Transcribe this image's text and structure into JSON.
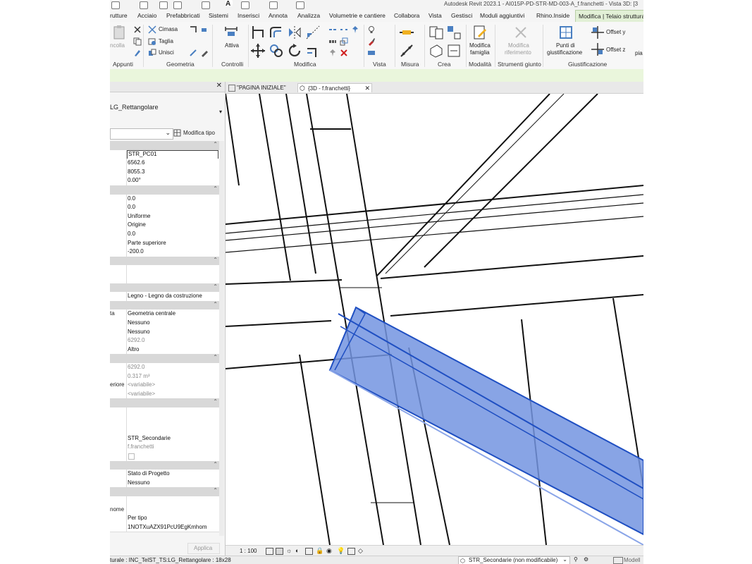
{
  "window": {
    "title": "Autodesk Revit 2023.1 - AI015P-PD-STR-MD-003-A_f.franchetti - Vista 3D: [3"
  },
  "ribbon_tabs": [
    "rutture",
    "Acciaio",
    "Prefabbricati",
    "Sistemi",
    "Inserisci",
    "Annota",
    "Analizza",
    "Volumetrie e cantiere",
    "Collabora",
    "Vista",
    "Gestisci",
    "Moduli aggiuntivi",
    "Rhino.Inside",
    "Modifica | Telaio struttura"
  ],
  "ribbon": {
    "groups": [
      "Appunti",
      "Geometria",
      "Controlli",
      "Modifica",
      "Vista",
      "Misura",
      "Crea",
      "Modalità",
      "Strumenti giunto",
      "Giustificazione"
    ],
    "clipboard_label": "ncolla",
    "cimasa_label": "Cimasa",
    "taglia_label": "Taglia",
    "unisci_label": "Unisci",
    "attiva_label": "Attiva",
    "modifica_famiglia_1": "Modifica",
    "modifica_famiglia_2": "famiglia",
    "modifica_rif_1": "Modifica",
    "modifica_rif_2": "riferimento",
    "punti_1": "Punti di",
    "punti_2": "giustificazione",
    "offset_y": "Offset y",
    "offset_z": "Offset z",
    "pia": "pia"
  },
  "properties": {
    "type_name": "LG_Rettangolare",
    "edit_type_label": "Modifica tipo",
    "apply_label": "Applica",
    "rows": [
      {
        "k": "",
        "v": "",
        "hdr": true
      },
      {
        "k": "",
        "v": "STR_PC01",
        "boxed": true
      },
      {
        "k": "",
        "v": "6562.6"
      },
      {
        "k": "",
        "v": "8055.3"
      },
      {
        "k": "",
        "v": "0.00°"
      },
      {
        "k": "",
        "v": "",
        "hdr": true
      },
      {
        "k": "",
        "v": "0.0"
      },
      {
        "k": "",
        "v": "0.0"
      },
      {
        "k": "",
        "v": "Uniforme"
      },
      {
        "k": "",
        "v": "Origine"
      },
      {
        "k": "",
        "v": "0.0"
      },
      {
        "k": "",
        "v": "Parte superiore"
      },
      {
        "k": "",
        "v": "-200.0"
      },
      {
        "k": "",
        "v": "",
        "hdr": true
      },
      {
        "k": "",
        "v": ""
      },
      {
        "k": "",
        "v": ""
      },
      {
        "k": "",
        "v": "",
        "hdr": true
      },
      {
        "k": "",
        "v": "Legno - Legno da costruzione"
      },
      {
        "k": "",
        "v": "",
        "hdr": true
      },
      {
        "k": "ta",
        "v": "Geometria centrale"
      },
      {
        "k": "",
        "v": "Nessuno"
      },
      {
        "k": "",
        "v": "Nessuno"
      },
      {
        "k": "",
        "v": "6292.0",
        "grey": true
      },
      {
        "k": "",
        "v": "Altro"
      },
      {
        "k": "",
        "v": "",
        "hdr": true
      },
      {
        "k": "",
        "v": "6292.0",
        "grey": true
      },
      {
        "k": "",
        "v": "0.317 m³",
        "grey": true
      },
      {
        "k": "eriore",
        "v": "<variabile>",
        "grey": true
      },
      {
        "k": "",
        "v": "<variabile>",
        "grey": true
      },
      {
        "k": "",
        "v": "",
        "hdr": true
      },
      {
        "k": "",
        "v": ""
      },
      {
        "k": "",
        "v": ""
      },
      {
        "k": "",
        "v": ""
      },
      {
        "k": "",
        "v": "STR_Secondarie"
      },
      {
        "k": "",
        "v": "f.franchetti",
        "grey": true
      },
      {
        "k": "",
        "v": "",
        "check": true
      },
      {
        "k": "",
        "v": "",
        "hdr": true
      },
      {
        "k": "",
        "v": "Stato di Progetto"
      },
      {
        "k": "",
        "v": "Nessuno"
      },
      {
        "k": "",
        "v": "",
        "hdr": true
      },
      {
        "k": "",
        "v": ""
      },
      {
        "k": "nome",
        "v": ""
      },
      {
        "k": "",
        "v": "Per tipo"
      },
      {
        "k": "",
        "v": "1NOTXuAZX91PcU9EgKmhom"
      }
    ]
  },
  "view_tabs": [
    {
      "label": "\"PAGINA INIZIALE\"",
      "active": false
    },
    {
      "label": "{3D - f.franchetti}",
      "active": true
    }
  ],
  "view_bar": {
    "scale": "1 : 100"
  },
  "status": {
    "selection": "turale : INC_TelST_TS:LG_Rettangolare : 18x28",
    "workset": "STR_Secondarie (non modificabile)",
    "model": "Modell"
  },
  "colors": {
    "accent_green": "#e2f0d6",
    "selection_blue": "#1f4fc2",
    "selection_fill": "#7394e0"
  }
}
